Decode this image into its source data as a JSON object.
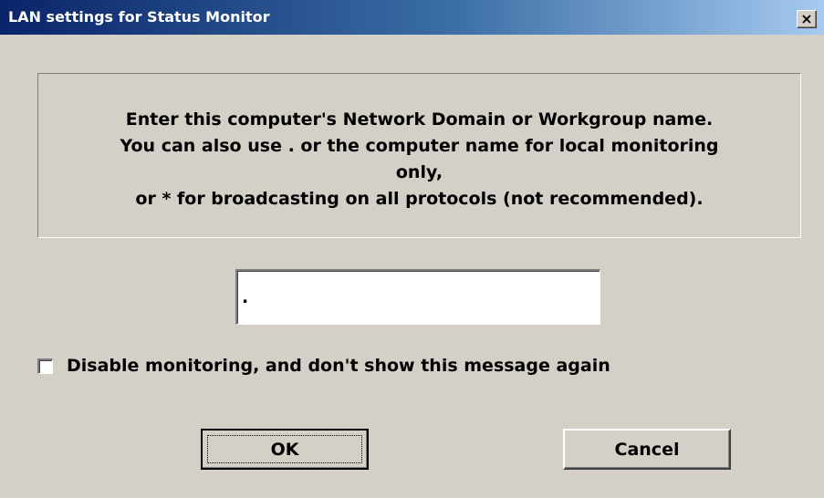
{
  "window": {
    "title": "LAN settings for Status Monitor",
    "close_glyph": "×"
  },
  "message": {
    "lines": [
      "Enter this computer's Network Domain or Workgroup name.",
      "You can also use . or the computer name for local monitoring",
      "only,",
      "or * for broadcasting on all protocols (not recommended)."
    ]
  },
  "domain_input": {
    "value": "."
  },
  "disable_checkbox": {
    "label": "Disable monitoring, and don't show this message again",
    "checked": false
  },
  "buttons": {
    "ok_label": "OK",
    "cancel_label": "Cancel"
  },
  "colors": {
    "dialog_face": "#d4d0c8",
    "titlebar_start": "#0a246a",
    "titlebar_end": "#a6caf0"
  },
  "icons": {
    "close": "close-icon"
  }
}
